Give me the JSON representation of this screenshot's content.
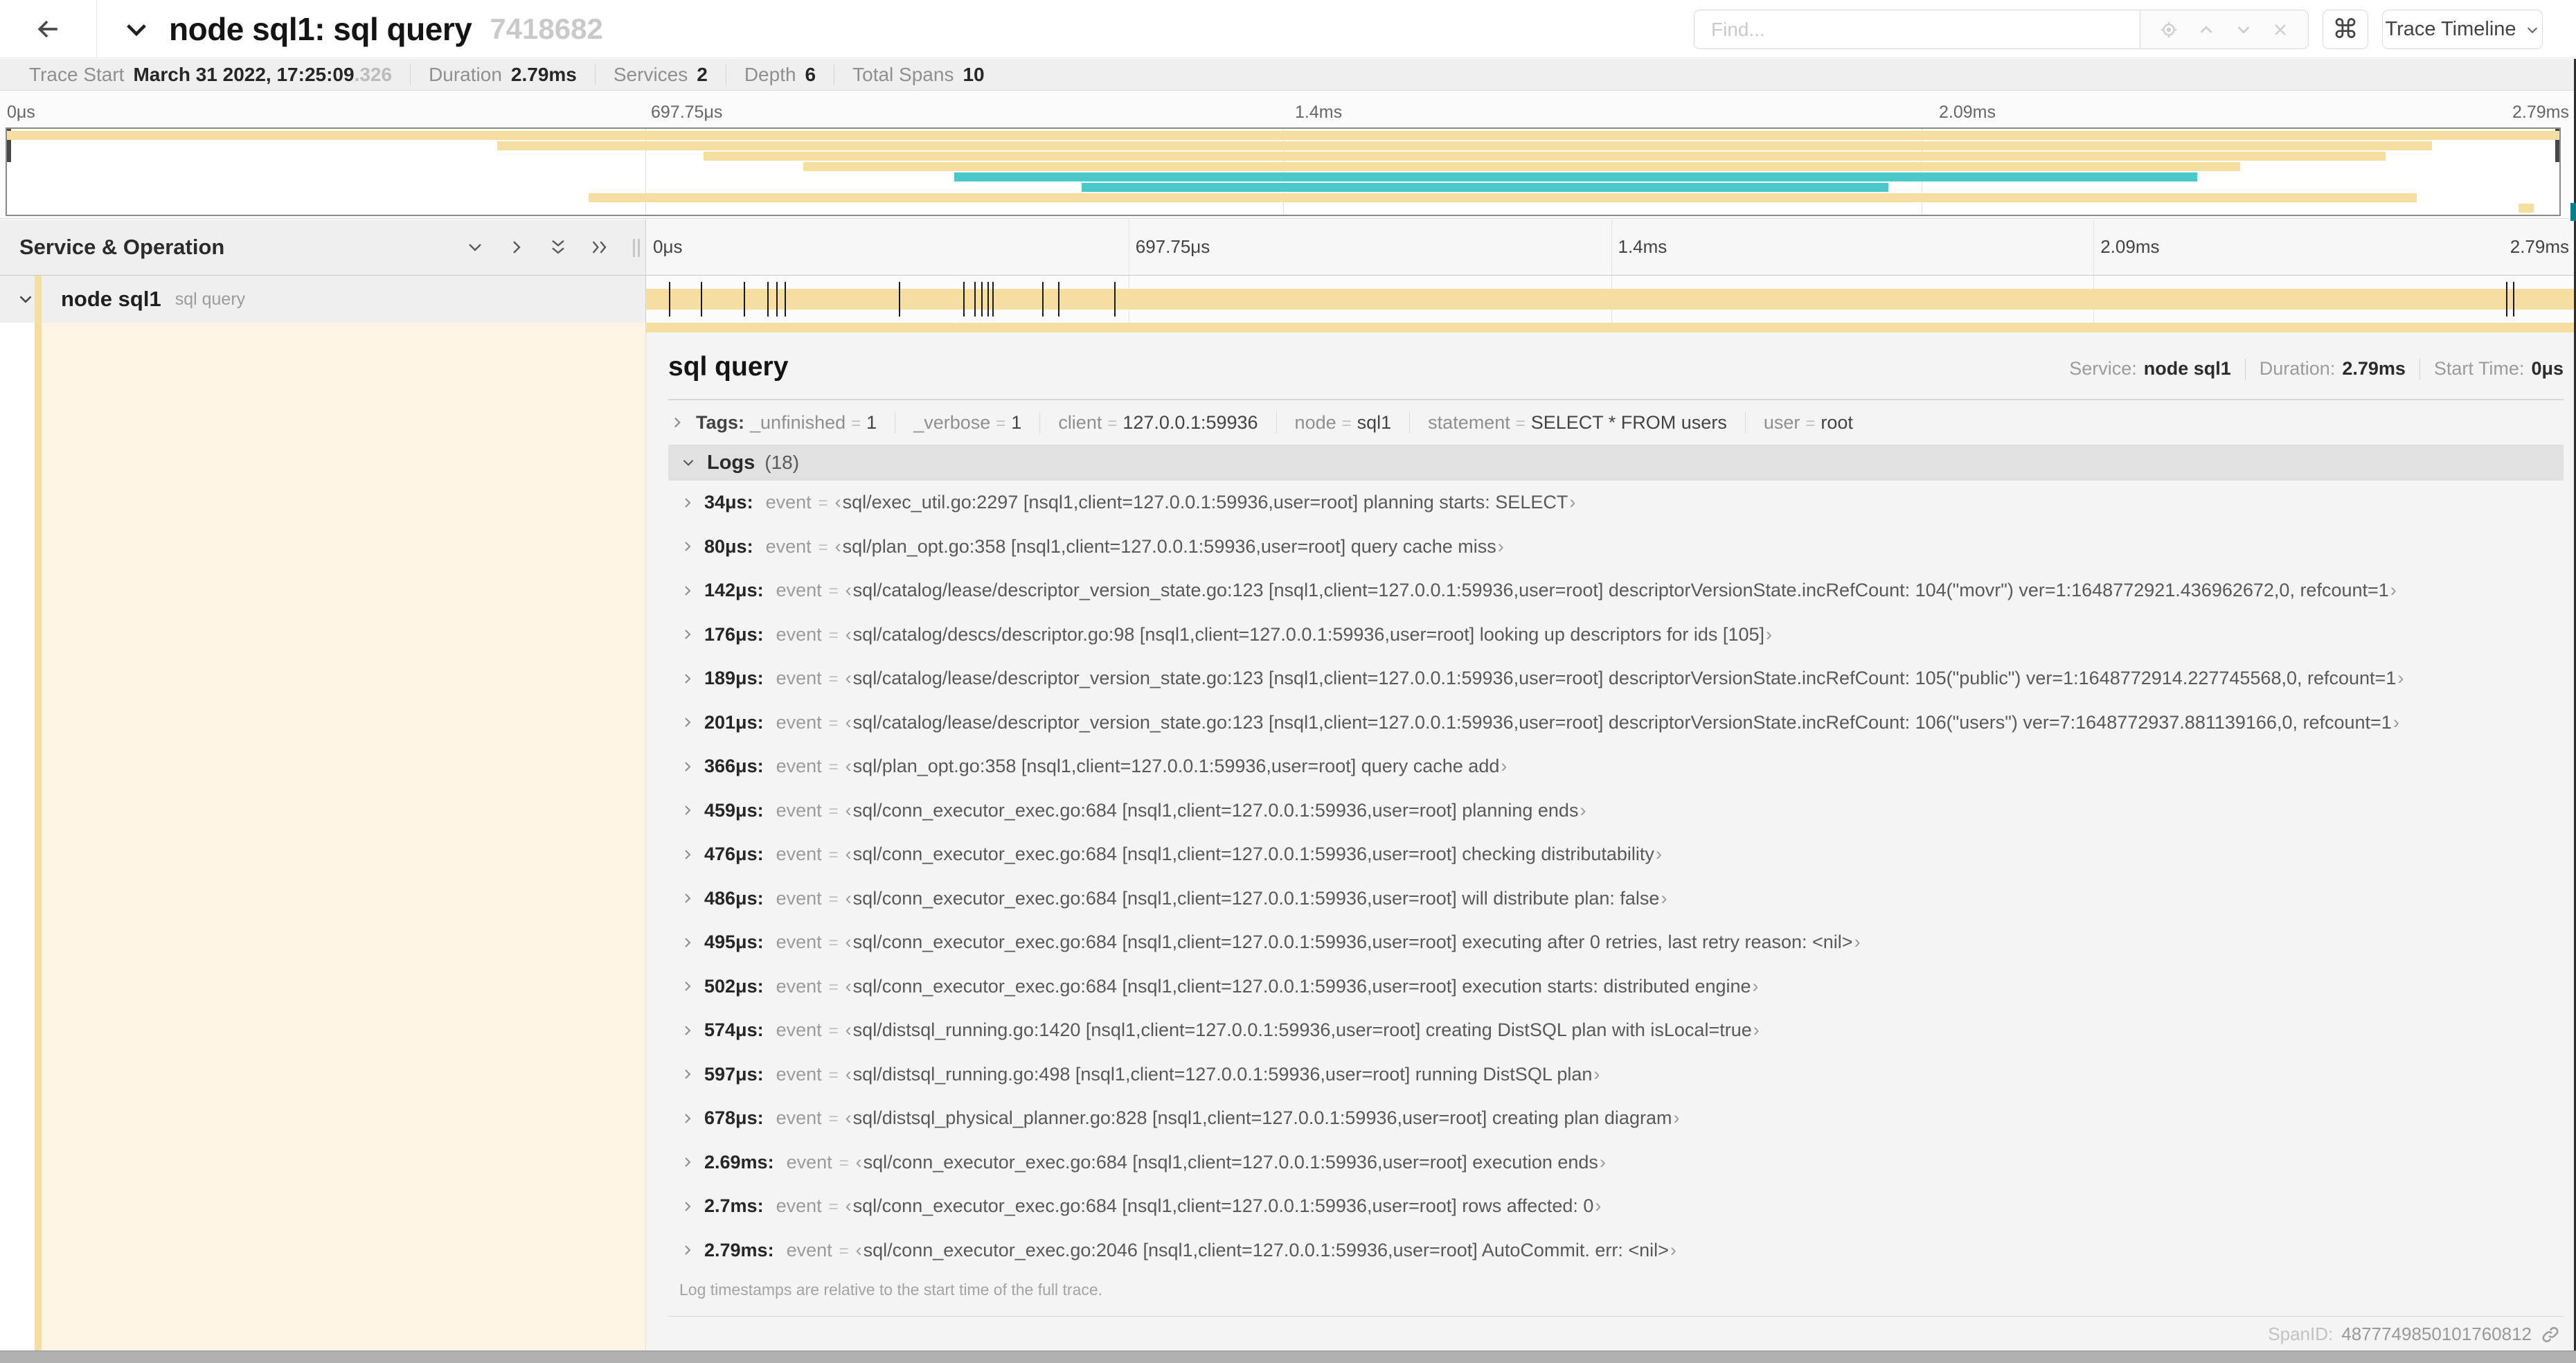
{
  "window": {
    "header": {
      "title": "node sql1: sql query",
      "trace_id": "7418682",
      "find_placeholder": "Find...",
      "keyboard_shortcut": "⌘",
      "view_selector_label": "Trace Timeline"
    },
    "trace_info": [
      {
        "label": "Trace Start",
        "value": "March 31 2022, 17:25:09",
        "suffix": ".326"
      },
      {
        "label": "Duration",
        "value": "2.79ms",
        "suffix": ""
      },
      {
        "label": "Services",
        "value": "2",
        "suffix": ""
      },
      {
        "label": "Depth",
        "value": "6",
        "suffix": ""
      },
      {
        "label": "Total Spans",
        "value": "10",
        "suffix": ""
      }
    ]
  },
  "minimap": {
    "ticks": [
      "0μs",
      "697.75μs",
      "1.4ms",
      "2.09ms",
      "2.79ms"
    ],
    "spans": [
      {
        "start": 0.0,
        "end": 1.0,
        "color": "#F6DEA1"
      },
      {
        "start": 0.192,
        "end": 0.95,
        "color": "#F6DEA1"
      },
      {
        "start": 0.273,
        "end": 0.932,
        "color": "#F6DEA1"
      },
      {
        "start": 0.312,
        "end": 0.875,
        "color": "#F6DEA1"
      },
      {
        "start": 0.371,
        "end": 0.858,
        "color": "#4CC7CA"
      },
      {
        "start": 0.421,
        "end": 0.737,
        "color": "#4CC7CA"
      },
      {
        "start": 0.228,
        "end": 0.944,
        "color": "#F6DEA1"
      },
      {
        "start": 0.984,
        "end": 0.99,
        "color": "#F6DEA1"
      }
    ]
  },
  "timeline": {
    "left_header": "Service & Operation",
    "ticks": [
      "0μs",
      "697.75μs",
      "1.4ms",
      "2.09ms",
      "2.79ms"
    ],
    "total_us": 2790,
    "row": {
      "service": "node sql1",
      "operation": "sql query"
    }
  },
  "detail": {
    "title": "sql query",
    "meta": {
      "service_label": "Service:",
      "service": "node sql1",
      "duration_label": "Duration:",
      "duration": "2.79ms",
      "start_label": "Start Time:",
      "start": "0μs"
    },
    "tags_label": "Tags:",
    "tags": [
      {
        "key": "_unfinished",
        "value": "1"
      },
      {
        "key": "_verbose",
        "value": "1"
      },
      {
        "key": "client",
        "value": "127.0.0.1:59936"
      },
      {
        "key": "node",
        "value": "sql1"
      },
      {
        "key": "statement",
        "value": "SELECT * FROM users"
      },
      {
        "key": "user",
        "value": "root"
      }
    ],
    "logs_label": "Logs",
    "logs_count": "(18)",
    "logs_field_label": "event",
    "logs": [
      {
        "t": 34,
        "time": "34μs",
        "msg": "sql/exec_util.go:2297 [nsql1,client=127.0.0.1:59936,user=root] planning starts: SELECT"
      },
      {
        "t": 80,
        "time": "80μs",
        "msg": "sql/plan_opt.go:358 [nsql1,client=127.0.0.1:59936,user=root] query cache miss"
      },
      {
        "t": 142,
        "time": "142μs",
        "msg": "sql/catalog/lease/descriptor_version_state.go:123 [nsql1,client=127.0.0.1:59936,user=root] descriptorVersionState.incRefCount: 104(\"movr\") ver=1:1648772921.436962672,0, refcount=1"
      },
      {
        "t": 176,
        "time": "176μs",
        "msg": "sql/catalog/descs/descriptor.go:98 [nsql1,client=127.0.0.1:59936,user=root] looking up descriptors for ids [105]"
      },
      {
        "t": 189,
        "time": "189μs",
        "msg": "sql/catalog/lease/descriptor_version_state.go:123 [nsql1,client=127.0.0.1:59936,user=root] descriptorVersionState.incRefCount: 105(\"public\") ver=1:1648772914.227745568,0, refcount=1"
      },
      {
        "t": 201,
        "time": "201μs",
        "msg": "sql/catalog/lease/descriptor_version_state.go:123 [nsql1,client=127.0.0.1:59936,user=root] descriptorVersionState.incRefCount: 106(\"users\") ver=7:1648772937.881139166,0, refcount=1"
      },
      {
        "t": 366,
        "time": "366μs",
        "msg": "sql/plan_opt.go:358 [nsql1,client=127.0.0.1:59936,user=root] query cache add"
      },
      {
        "t": 459,
        "time": "459μs",
        "msg": "sql/conn_executor_exec.go:684 [nsql1,client=127.0.0.1:59936,user=root] planning ends"
      },
      {
        "t": 476,
        "time": "476μs",
        "msg": "sql/conn_executor_exec.go:684 [nsql1,client=127.0.0.1:59936,user=root] checking distributability"
      },
      {
        "t": 486,
        "time": "486μs",
        "msg": "sql/conn_executor_exec.go:684 [nsql1,client=127.0.0.1:59936,user=root] will distribute plan: false"
      },
      {
        "t": 495,
        "time": "495μs",
        "msg": "sql/conn_executor_exec.go:684 [nsql1,client=127.0.0.1:59936,user=root] executing after 0 retries, last retry reason: <nil>"
      },
      {
        "t": 502,
        "time": "502μs",
        "msg": "sql/conn_executor_exec.go:684 [nsql1,client=127.0.0.1:59936,user=root] execution starts: distributed engine"
      },
      {
        "t": 574,
        "time": "574μs",
        "msg": "sql/distsql_running.go:1420 [nsql1,client=127.0.0.1:59936,user=root] creating DistSQL plan with isLocal=true"
      },
      {
        "t": 597,
        "time": "597μs",
        "msg": "sql/distsql_running.go:498 [nsql1,client=127.0.0.1:59936,user=root] running DistSQL plan"
      },
      {
        "t": 678,
        "time": "678μs",
        "msg": "sql/distsql_physical_planner.go:828 [nsql1,client=127.0.0.1:59936,user=root] creating plan diagram"
      },
      {
        "t": 2690,
        "time": "2.69ms",
        "msg": "sql/conn_executor_exec.go:684 [nsql1,client=127.0.0.1:59936,user=root] execution ends"
      },
      {
        "t": 2700,
        "time": "2.7ms",
        "msg": "sql/conn_executor_exec.go:684 [nsql1,client=127.0.0.1:59936,user=root] rows affected: 0"
      },
      {
        "t": 2790,
        "time": "2.79ms",
        "msg": "sql/conn_executor_exec.go:2046 [nsql1,client=127.0.0.1:59936,user=root] AutoCommit. err: <nil>"
      }
    ],
    "logs_note": "Log timestamps are relative to the start time of the full trace.",
    "span_id_label": "SpanID:",
    "span_id": "4877749850101760812"
  },
  "colors": {
    "span_bar": "#F6DEA1",
    "span_teal": "#4CC7CA",
    "detail_left_fill": "#FCF5E4",
    "scroll_thumb": "#0C7E86"
  }
}
